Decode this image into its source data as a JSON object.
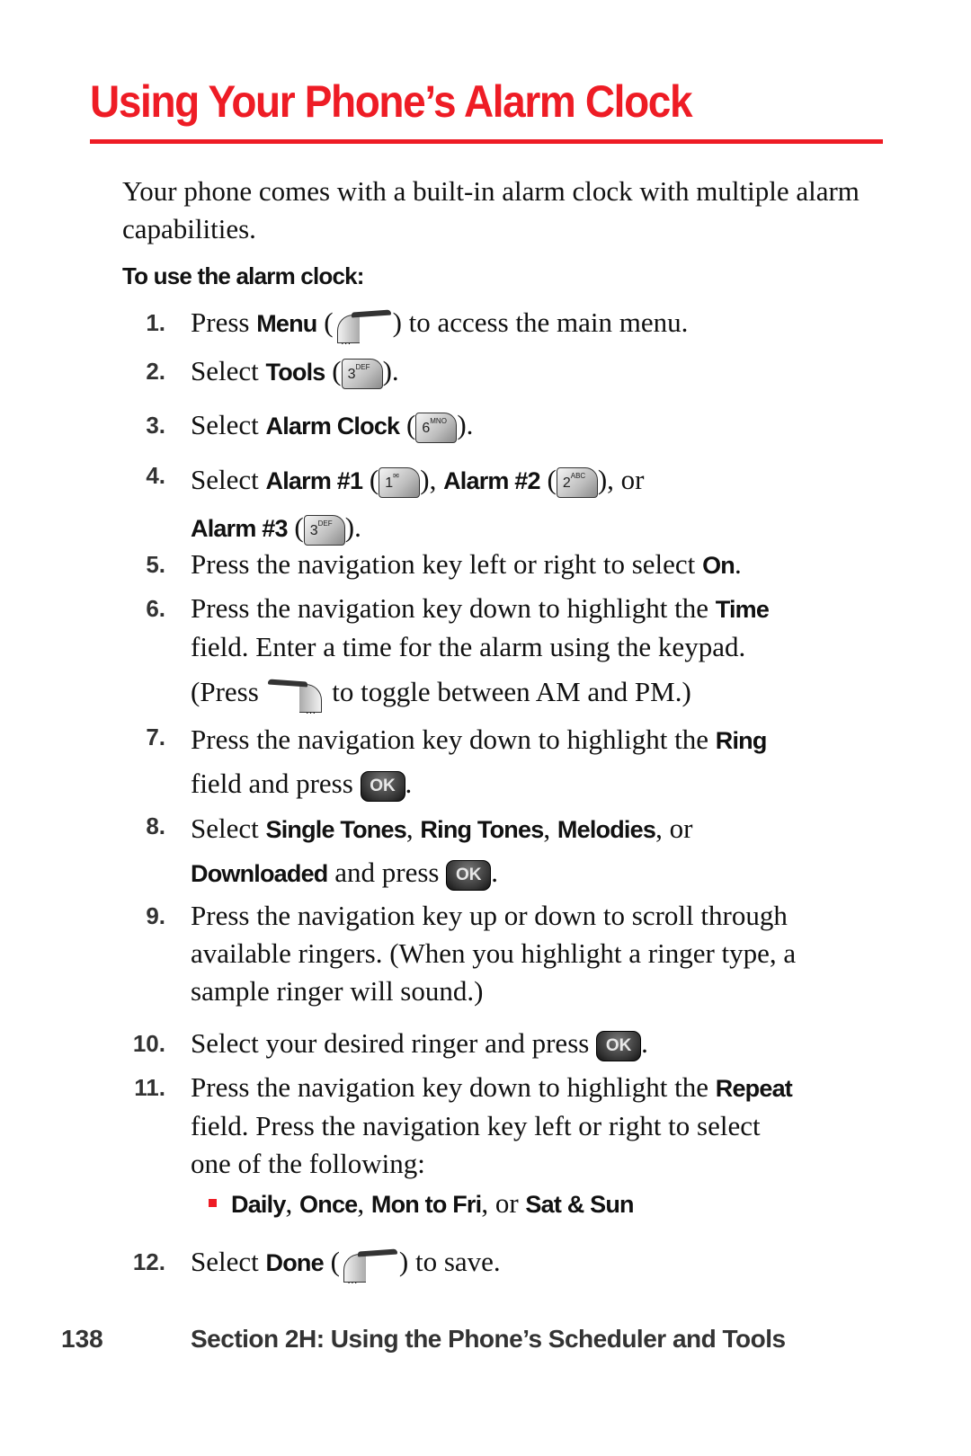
{
  "page": {
    "title": "Using Your Phone’s Alarm Clock",
    "intro": "Your phone comes with a built-in alarm clock with multiple alarm capabilities.",
    "subhead": "To use the alarm clock:",
    "accent_color": "#ee1c25"
  },
  "keys": {
    "menu": "menu-softkey-left-icon",
    "tools": {
      "digit": "3",
      "letters": "DEF"
    },
    "alarm_clock": {
      "digit": "6",
      "letters": "MNO"
    },
    "alarm1": {
      "digit": "1",
      "letters": "✉"
    },
    "alarm2": {
      "digit": "2",
      "letters": "ABC"
    },
    "alarm3": {
      "digit": "3",
      "letters": "DEF"
    },
    "ok": "OK",
    "dots": "…"
  },
  "steps": [
    {
      "num": "1.",
      "pre": "Press ",
      "b1": "Menu",
      "mid": " (",
      "post": ") to access the main menu."
    },
    {
      "num": "2.",
      "pre": "Select ",
      "b1": "Tools",
      "mid": " (",
      "post": ")."
    },
    {
      "num": "3.",
      "pre": "Select ",
      "b1": "Alarm Clock",
      "mid": " (",
      "post": ")."
    },
    {
      "num": "4.",
      "pre": "Select ",
      "b1": "Alarm #1",
      "mid": " (",
      "mid2": "), ",
      "b2": "Alarm #2",
      "mid3": " (",
      "post": "), or",
      "b3": "Alarm #3",
      "mid4": " (",
      "post2": ")."
    },
    {
      "num": "5.",
      "pre": "Press the navigation key left or right to select ",
      "b1": "On",
      "post": "."
    },
    {
      "num": "6.",
      "pre": "Press the navigation key down to highlight the ",
      "b1": "Time",
      "line2": "field. Enter a time for the alarm using the keypad.",
      "line3a": "(Press ",
      "line3b": " to toggle between AM and PM.)"
    },
    {
      "num": "7.",
      "pre": "Press the navigation key down to highlight the ",
      "b1": "Ring",
      "line2": "field and press ",
      "post": "."
    },
    {
      "num": "8.",
      "pre": "Select ",
      "b1": "Single Tones",
      "c1": ", ",
      "b2": "Ring Tones",
      "c2": ", ",
      "b3": "Melodies",
      "c3": ", or",
      "b4": "Downloaded",
      "line2": " and press ",
      "post": "."
    },
    {
      "num": "9.",
      "line1": "Press the navigation key up or down to scroll through",
      "line2": "available ringers. (When you highlight a ringer type, a",
      "line3": "sample ringer will sound.)"
    },
    {
      "num": "10.",
      "pre": "Select your desired ringer and press ",
      "post": "."
    },
    {
      "num": "11.",
      "pre": "Press the navigation key down to highlight the ",
      "b1": "Repeat",
      "line2": "field. Press the navigation key left or right to select",
      "line3": "one of the following:"
    },
    {
      "num": "12.",
      "pre": "Select ",
      "b1": "Done",
      "mid": " (",
      "post": ") to save."
    }
  ],
  "repeat_options": {
    "o1": "Daily",
    "s1": ", ",
    "o2": "Once",
    "s2": ", ",
    "o3": "Mon to Fri",
    "s3": ", or ",
    "o4": "Sat & Sun"
  },
  "footer": {
    "page_number": "138",
    "section": "Section 2H: Using the Phone’s Scheduler and Tools"
  }
}
